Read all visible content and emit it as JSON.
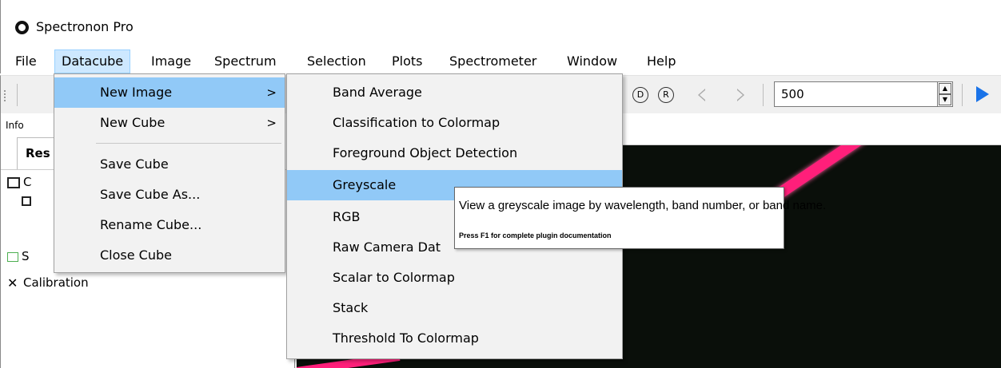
{
  "window": {
    "title": "Spectronon Pro"
  },
  "menubar": {
    "items": [
      "File",
      "Datacube",
      "Image",
      "Spectrum",
      "Selection",
      "Plots",
      "Spectrometer",
      "Window",
      "Help"
    ],
    "active": "Datacube"
  },
  "toolbar": {
    "d_button": "D",
    "r_button": "R",
    "band_value": "500"
  },
  "left_pane": {
    "info_label": "Info",
    "tab_label": "Res",
    "tree": {
      "cube_label": "C",
      "spectrum_label": "S",
      "calibration_label": "Calibration"
    }
  },
  "datacube_menu": {
    "items": [
      {
        "label": "New Image",
        "arrow": ">"
      },
      {
        "label": "New Cube",
        "arrow": ">"
      },
      {
        "label": "Save Cube"
      },
      {
        "label": "Save Cube As..."
      },
      {
        "label": "Rename Cube..."
      },
      {
        "label": "Close Cube"
      }
    ]
  },
  "new_image_submenu": {
    "items": [
      "Band Average",
      "Classification to Colormap",
      "Foreground Object Detection",
      "Greyscale",
      "RGB",
      "Raw Camera Dat",
      "Scalar to Colormap",
      "Stack",
      "Threshold To Colormap"
    ],
    "highlighted": "Greyscale"
  },
  "tooltip": {
    "text": "View a greyscale image by wavelength, band number, or band name.",
    "hint": "Press F1 for complete plugin documentation"
  },
  "colors": {
    "highlight": "#91c9f7",
    "streak": "#ff1f7a",
    "play": "#1a73e8"
  }
}
